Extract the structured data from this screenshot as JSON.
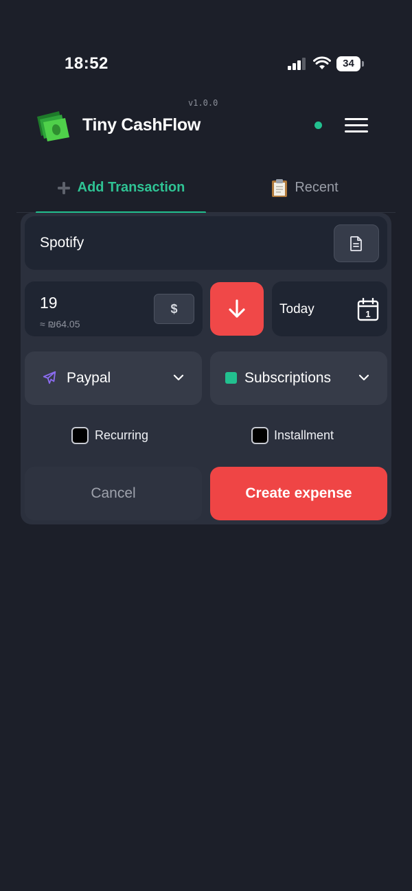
{
  "status_bar": {
    "time": "18:52",
    "battery_level": "34"
  },
  "header": {
    "version": "v1.0.0",
    "app_name": "Tiny CashFlow",
    "logo_icon": "cash-stack-icon",
    "online_color": "#22c08f"
  },
  "tabs": [
    {
      "label": "Add Transaction",
      "icon": "plus-icon",
      "active": true
    },
    {
      "label": "Recent",
      "icon": "clipboard-icon",
      "active": false
    }
  ],
  "form": {
    "description": "Spotify",
    "amount": "19",
    "converted_amount": "≈ ₪64.05",
    "currency_symbol": "$",
    "type_icon": "arrow-down-icon",
    "date": "Today",
    "account": {
      "label": "Paypal",
      "icon": "plane-icon",
      "icon_color": "#8b6cf0"
    },
    "category": {
      "label": "Subscriptions",
      "color": "#22c08f"
    },
    "recurring": {
      "label": "Recurring",
      "checked": false
    },
    "installment": {
      "label": "Installment",
      "checked": false
    },
    "cancel_label": "Cancel",
    "submit_label": "Create expense"
  },
  "colors": {
    "background": "#1c1f29",
    "accent": "#22c08f",
    "expense": "#ef4545"
  }
}
